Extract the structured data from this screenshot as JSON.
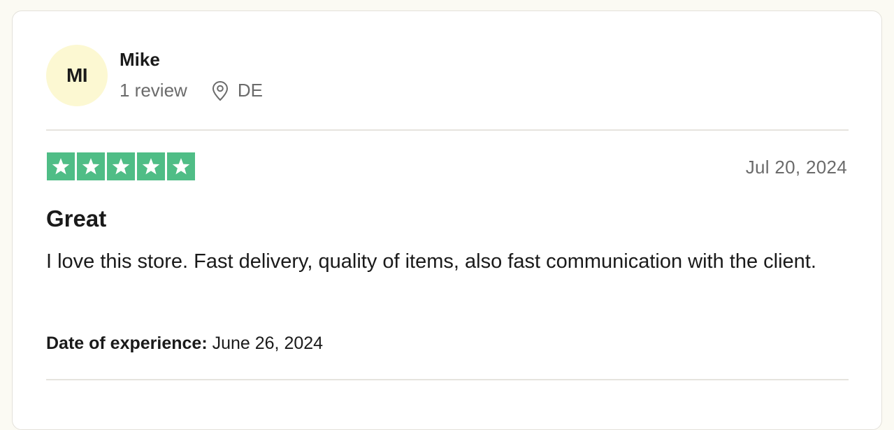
{
  "reviewer": {
    "initials": "MI",
    "name": "Mike",
    "review_count": "1 review",
    "country": "DE",
    "avatar_color": "#fcf8d2",
    "location_icon": "location-pin-icon"
  },
  "review": {
    "rating": 5,
    "rating_max": 5,
    "star_color": "#4fbd86",
    "star_icon": "star-icon",
    "date": "Jul 20, 2024",
    "title": "Great",
    "body": "I love this store. Fast delivery, quality of items, also fast communication with the client.",
    "experience_label": "Date of experience:",
    "experience_date": "June 26, 2024"
  }
}
